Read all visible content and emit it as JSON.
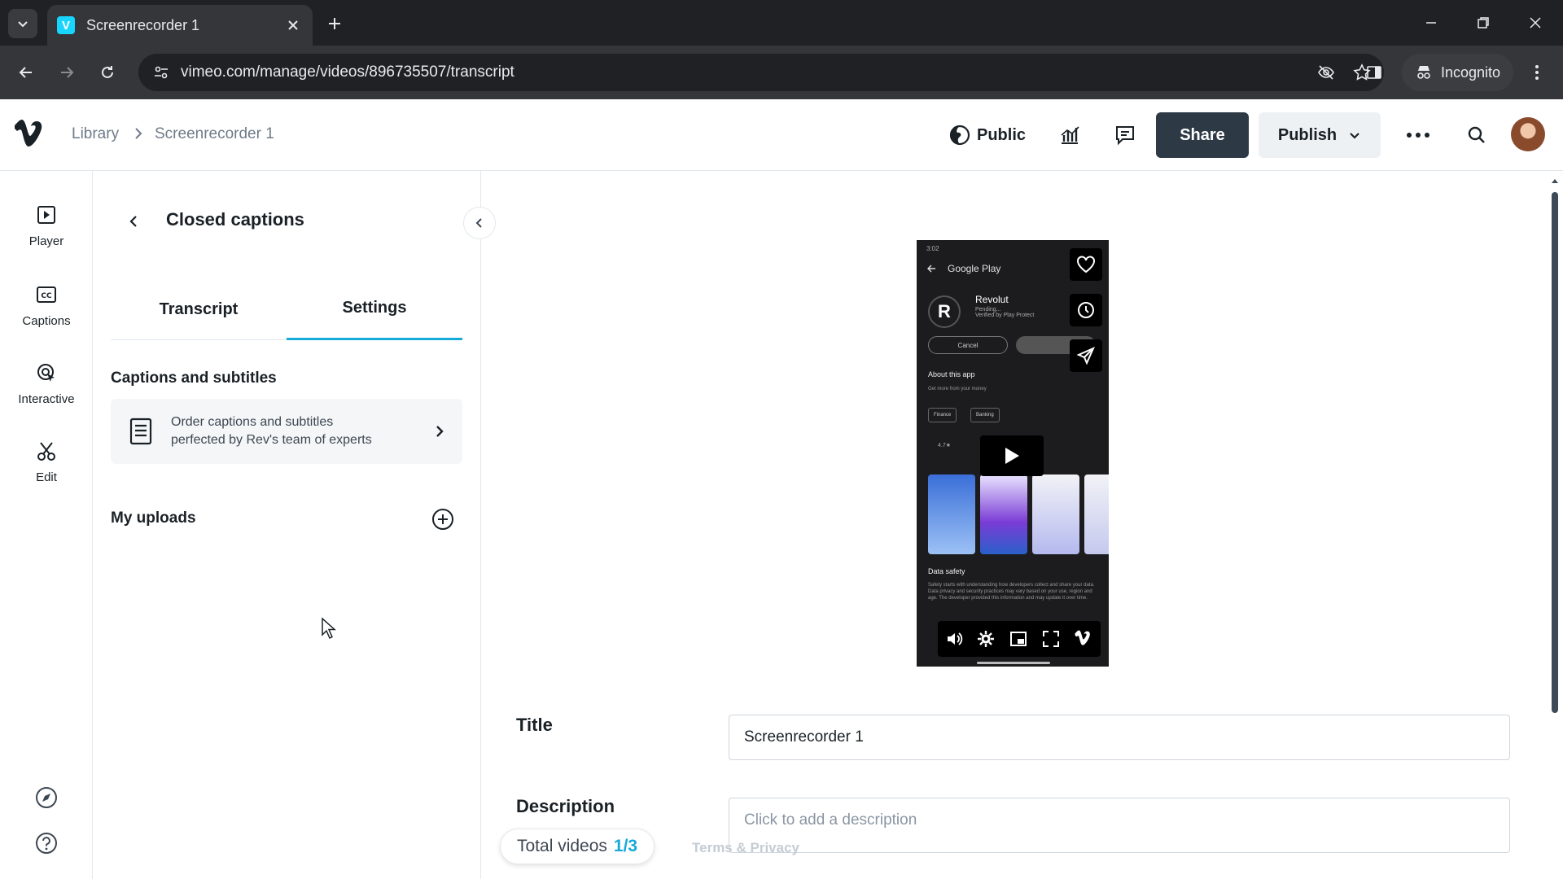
{
  "browser": {
    "tab_title": "Screenrecorder 1",
    "tab_favicon_letter": "V",
    "url": "vimeo.com/manage/videos/896735507/transcript",
    "incognito_label": "Incognito"
  },
  "header": {
    "breadcrumb_library": "Library",
    "breadcrumb_current": "Screenrecorder 1",
    "privacy_label": "Public",
    "share_label": "Share",
    "publish_label": "Publish"
  },
  "rail": {
    "items": [
      {
        "label": "Player",
        "icon": "player-icon"
      },
      {
        "label": "Captions",
        "icon": "captions-icon"
      },
      {
        "label": "Interactive",
        "icon": "interactive-icon"
      },
      {
        "label": "Edit",
        "icon": "scissors-icon"
      }
    ]
  },
  "panel": {
    "title": "Closed captions",
    "tabs": [
      {
        "label": "Transcript",
        "active": false
      },
      {
        "label": "Settings",
        "active": true
      }
    ],
    "captions_section_label": "Captions and subtitles",
    "order_text_line1": "Order captions and subtitles",
    "order_text_line2": "perfected by Rev's team of experts",
    "uploads_section_label": "My uploads"
  },
  "video": {
    "status_time": "3:02",
    "store_title": "Google Play",
    "app_logo_letter": "R",
    "app_name": "Revolut",
    "app_status": "Pending...",
    "app_verified": "Verified by Play Protect",
    "cancel_label": "Cancel",
    "about_title": "About this app",
    "about_sub": "Get more from your money",
    "chip_1": "Finance",
    "chip_2": "Banking",
    "stat_rating": "4.7★",
    "data_safety_title": "Data safety",
    "data_safety_text": "Safety starts with understanding how developers collect and share your data. Data privacy and security practices may vary based on your use, region and age. The developer provided this information and may update it over time."
  },
  "form": {
    "title_label": "Title",
    "title_value": "Screenrecorder 1",
    "description_label": "Description",
    "description_placeholder": "Click to add a description"
  },
  "footer": {
    "total_label": "Total videos",
    "total_count": "1/3",
    "terms_label": "Terms & Privacy"
  },
  "colors": {
    "accent": "#17a9d8",
    "share_bg": "#2d3a46",
    "chrome_dark": "#202124",
    "chrome_toolbar": "#35363a"
  }
}
